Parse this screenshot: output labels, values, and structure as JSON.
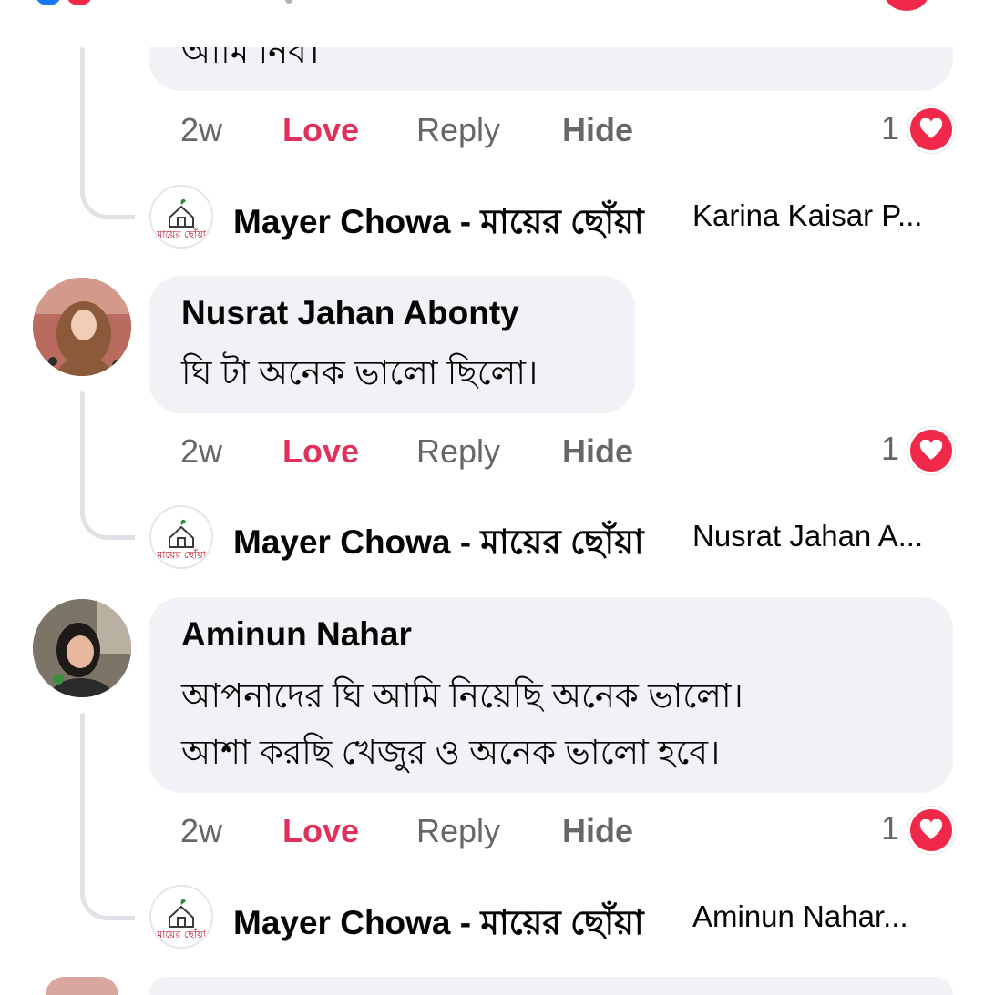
{
  "top": {
    "partial_text": "আমি নিব।",
    "time": "2w",
    "love": "Love",
    "reply": "Reply",
    "hide": "Hide",
    "reaction_count": "1",
    "reply_preview": {
      "page_name": "Mayer Chowa - মায়ের ছোঁয়া",
      "snippet": "Karina Kaisar P..."
    }
  },
  "comments": [
    {
      "author": "Nusrat Jahan Abonty",
      "lines": [
        "ঘি টা অনেক ভালো ছিলো।"
      ],
      "time": "2w",
      "love": "Love",
      "reply": "Reply",
      "hide": "Hide",
      "reaction_count": "1",
      "reply_preview": {
        "page_name": "Mayer Chowa - মায়ের ছোঁয়া",
        "snippet": "Nusrat Jahan A..."
      }
    },
    {
      "author": "Aminun Nahar",
      "lines": [
        "আপনাদের ঘি আমি নিয়েছি অনেক ভালো।",
        "আশা করছি খেজুর ও অনেক ভালো হবে।"
      ],
      "time": "2w",
      "love": "Love",
      "reply": "Reply",
      "hide": "Hide",
      "reaction_count": "1",
      "reply_preview": {
        "page_name": "Mayer Chowa - মায়ের ছোঁয়া",
        "snippet": "Aminun Nahar..."
      }
    }
  ],
  "page_logo_text": "মায়ের ছোঁয়া",
  "colors": {
    "love": "#e1305c",
    "heart": "#f02849",
    "bubble": "#f0f2f5",
    "meta": "#65676b"
  }
}
